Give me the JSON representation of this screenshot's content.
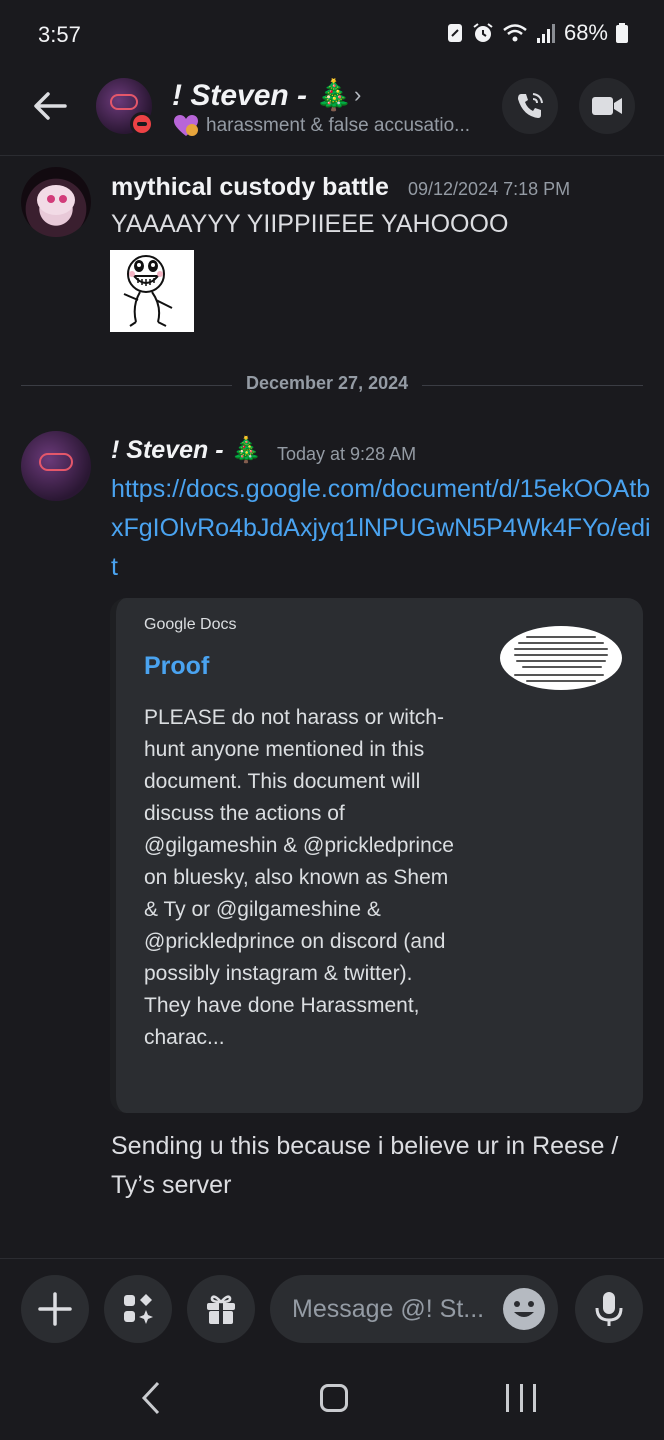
{
  "status_bar": {
    "time": "3:57",
    "battery": "68%",
    "icons": [
      "data-saver-icon",
      "alarm-icon",
      "wifi-icon",
      "signal-icon",
      "battery-icon"
    ]
  },
  "header": {
    "name": "! Steven -",
    "name_emoji": "🎄",
    "chevron": "›",
    "status_text": "harassment & false accusatio...",
    "status_emoji": "purple-heart-icon",
    "presence": "do-not-disturb"
  },
  "messages": [
    {
      "author": "mythical custody battle",
      "timestamp": "09/12/2024 7:18 PM",
      "text": "YAAAAYYY YIIPPIIEEE YAHOOOO",
      "attachment": "sticker"
    },
    {
      "author": "! Steven -",
      "author_emoji": "🎄",
      "timestamp": "Today at 9:28 AM",
      "link": "https://docs.google.com/document/d/15ekOOAtbxFgIOlvRo4bJdAxjyq1lNPUGwN5P4Wk4FYo/edit",
      "embed": {
        "provider": "Google Docs",
        "title": "Proof",
        "description": "PLEASE do not harass or witch-hunt anyone mentioned in this document. This document will discuss the actions of @gilgameshin & @prickledprince on bluesky, also known as Shem & Ty or @gilgameshine & @prickledprince on discord (and possibly instagram & twitter). They have done Harassment, charac..."
      },
      "followup_text": "Sending u this because i believe ur in Reese / Ty’s server"
    }
  ],
  "date_divider": "December 27, 2024",
  "composer": {
    "placeholder": "Message @! St...",
    "buttons": [
      "plus-icon",
      "apps-icon",
      "gift-icon",
      "emoji-icon",
      "microphone-icon"
    ]
  },
  "colors": {
    "background": "#1a1a1e",
    "link": "#4aa3f0",
    "embed_bg": "#2b2d31",
    "dnd": "#ed4245"
  }
}
